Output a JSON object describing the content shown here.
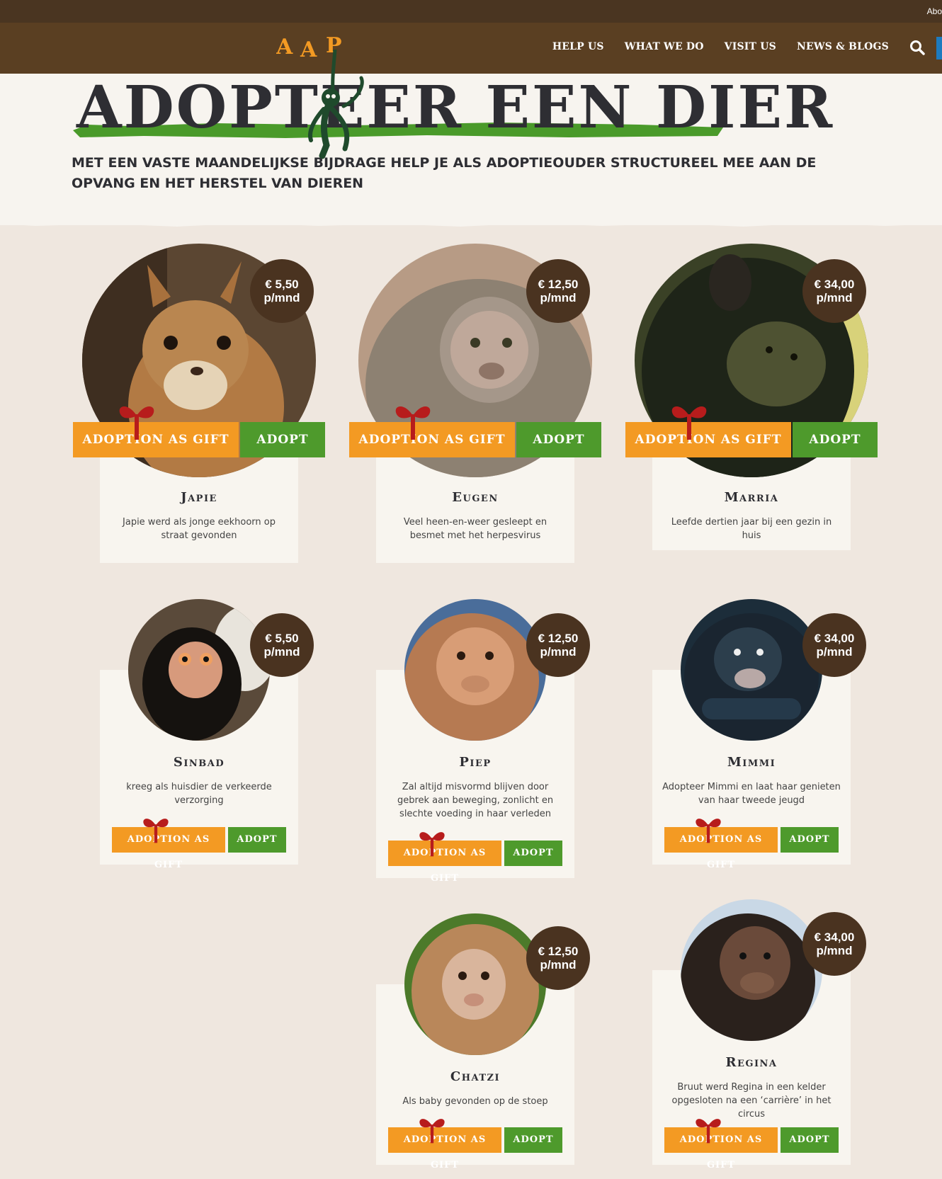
{
  "topbar": {
    "about": "Abo"
  },
  "nav": {
    "items": [
      "HELP US",
      "WHAT WE DO",
      "VISIT US",
      "NEWS & BLOGS"
    ]
  },
  "logo": {
    "text": "AAP"
  },
  "hero": {
    "title": "ADOPTEER EEN DIER",
    "intro": "MET EEN VASTE MAANDELIJKSE BIJDRAGE HELP JE ALS ADOPTIEOUDER STRUCTUREEL MEE AAN DE OPVANG EN HET HERSTEL VAN DIEREN"
  },
  "buttons": {
    "gift": "ADOPTION AS GIFT",
    "adopt": "ADOPT"
  },
  "animals": [
    {
      "name": "Japie",
      "price": "€ 5,50",
      "unit": "p/mnd",
      "desc": "Japie werd als jonge eekhoorn op straat gevonden"
    },
    {
      "name": "Eugen",
      "price": "€ 12,50",
      "unit": "p/mnd",
      "desc": "Veel heen-en-weer gesleept en besmet met het herpesvirus"
    },
    {
      "name": "Marria",
      "price": "€ 34,00",
      "unit": "p/mnd",
      "desc": "Leefde dertien jaar bij een gezin in huis"
    },
    {
      "name": "Sinbad",
      "price": "€ 5,50",
      "unit": "p/mnd",
      "desc": "kreeg als huisdier de verkeerde verzorging"
    },
    {
      "name": "Piep",
      "price": "€ 12,50",
      "unit": "p/mnd",
      "desc": "Zal altijd misvormd blijven door gebrek aan beweging, zonlicht en slechte voeding in haar verleden"
    },
    {
      "name": "Mimmi",
      "price": "€ 34,00",
      "unit": "p/mnd",
      "desc": "Adopteer Mimmi en laat haar genieten van haar tweede jeugd"
    },
    {
      "name": "Chatzi",
      "price": "€ 12,50",
      "unit": "p/mnd",
      "desc": "Als baby gevonden op de stoep"
    },
    {
      "name": "Regina",
      "price": "€ 34,00",
      "unit": "p/mnd",
      "desc": "Bruut werd Regina in een kelder opgesloten na een ‘carrière’ in het circus"
    }
  ],
  "colors": {
    "header": "#5a3f22",
    "orange": "#f39a23",
    "green": "#4e9a2c",
    "priceBadge": "#4a3320",
    "grass": "#4a9a2a"
  }
}
